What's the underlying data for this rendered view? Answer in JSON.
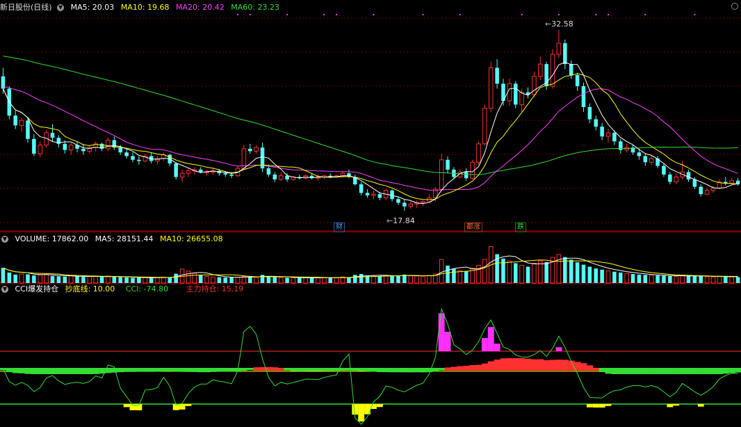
{
  "price_panel": {
    "title": "新日股份(日线)",
    "ma_labels": [
      {
        "text": "MA5: 20.03",
        "color": "#ffffff"
      },
      {
        "text": "MA10: 19.68",
        "color": "#ffff00"
      },
      {
        "text": "MA20: 20.42",
        "color": "#ff40ff"
      },
      {
        "text": "MA60: 23.23",
        "color": "#33dd33"
      }
    ],
    "high_label": "32.58",
    "low_label": "17.84",
    "flags": [
      {
        "text": "财",
        "color": "#4aa3ff"
      },
      {
        "text": "都涨",
        "color": "#ff6a3a"
      },
      {
        "text": "跌",
        "color": "#33dd33"
      }
    ]
  },
  "volume_panel": {
    "labels": [
      {
        "text": "VOLUME: 17862.00",
        "color": "#ffffff"
      },
      {
        "text": "MA5: 28151.44",
        "color": "#ffffff"
      },
      {
        "text": "MA10: 26655.08",
        "color": "#ffff00"
      }
    ]
  },
  "cci_panel": {
    "labels": [
      {
        "text": "CCI爆发持仓",
        "color": "#ffffff"
      },
      {
        "text": "抄底线: 10.00",
        "color": "#ffff00"
      },
      {
        "text": "CCI: -74.80",
        "color": "#33dd33"
      },
      {
        "text": "主力持仓: 15.19",
        "color": "#ff3030"
      }
    ]
  },
  "colors": {
    "up": "#ff3030",
    "down": "#54fcfc",
    "ma5": "#ffffff",
    "ma10": "#ffff00",
    "ma20": "#ff40ff",
    "ma60": "#33dd33",
    "grid": "#7a0000",
    "divider": "#a00000"
  },
  "chart_data": {
    "type": "candlestick",
    "high": 32.58,
    "low": 17.84,
    "ohlc": [
      [
        28.8,
        29.5,
        27.4,
        27.8
      ],
      [
        27.8,
        28.0,
        25.3,
        25.6
      ],
      [
        25.6,
        26.0,
        24.5,
        24.8
      ],
      [
        24.8,
        25.4,
        24.3,
        25.2
      ],
      [
        25.2,
        25.5,
        23.4,
        23.7
      ],
      [
        23.7,
        24.1,
        22.3,
        22.5
      ],
      [
        22.5,
        23.5,
        22.2,
        23.2
      ],
      [
        23.2,
        24.4,
        23.0,
        24.2
      ],
      [
        24.2,
        24.9,
        23.5,
        23.8
      ],
      [
        23.8,
        24.0,
        23.0,
        23.3
      ],
      [
        23.3,
        23.6,
        22.5,
        22.8
      ],
      [
        22.8,
        23.4,
        22.4,
        23.2
      ],
      [
        23.2,
        23.5,
        22.6,
        22.9
      ],
      [
        22.9,
        23.3,
        22.4,
        22.7
      ],
      [
        22.7,
        23.2,
        22.5,
        23.0
      ],
      [
        23.0,
        23.5,
        22.7,
        23.3
      ],
      [
        23.3,
        23.4,
        22.7,
        22.9
      ],
      [
        22.9,
        23.8,
        22.7,
        23.6
      ],
      [
        23.6,
        23.9,
        22.8,
        23.0
      ],
      [
        23.0,
        23.2,
        22.4,
        22.6
      ],
      [
        22.6,
        22.9,
        22.1,
        22.3
      ],
      [
        22.3,
        22.6,
        21.8,
        22.0
      ],
      [
        22.0,
        22.3,
        21.6,
        21.9
      ],
      [
        21.9,
        22.5,
        21.8,
        22.3
      ],
      [
        22.3,
        22.6,
        21.7,
        21.9
      ],
      [
        21.9,
        22.3,
        21.6,
        22.1
      ],
      [
        22.1,
        22.6,
        21.9,
        22.4
      ],
      [
        22.4,
        22.5,
        21.5,
        21.7
      ],
      [
        21.7,
        21.8,
        20.4,
        20.6
      ],
      [
        20.6,
        21.2,
        20.2,
        20.9
      ],
      [
        20.9,
        21.3,
        20.6,
        21.1
      ],
      [
        21.1,
        21.4,
        20.8,
        21.2
      ],
      [
        21.2,
        21.4,
        20.9,
        21.0
      ],
      [
        21.0,
        21.2,
        20.7,
        21.0
      ],
      [
        21.0,
        21.3,
        20.8,
        21.1
      ],
      [
        21.1,
        21.2,
        20.7,
        20.9
      ],
      [
        20.9,
        21.1,
        20.6,
        20.8
      ],
      [
        20.8,
        21.0,
        20.5,
        20.7
      ],
      [
        20.7,
        21.5,
        20.6,
        21.3
      ],
      [
        21.3,
        23.2,
        21.2,
        22.9
      ],
      [
        22.9,
        23.3,
        22.5,
        22.7
      ],
      [
        22.7,
        23.2,
        22.5,
        23.0
      ],
      [
        23.0,
        23.4,
        21.0,
        21.3
      ],
      [
        21.3,
        21.6,
        20.6,
        20.8
      ],
      [
        20.8,
        21.0,
        20.2,
        20.4
      ],
      [
        20.4,
        21.0,
        20.3,
        20.7
      ],
      [
        20.7,
        20.9,
        20.2,
        20.4
      ],
      [
        20.4,
        20.7,
        20.3,
        20.6
      ],
      [
        20.6,
        20.8,
        20.4,
        20.5
      ],
      [
        20.5,
        20.8,
        20.4,
        20.7
      ],
      [
        20.7,
        20.9,
        20.4,
        20.5
      ],
      [
        20.5,
        20.8,
        20.3,
        20.6
      ],
      [
        20.6,
        20.8,
        20.4,
        20.7
      ],
      [
        20.7,
        20.9,
        20.5,
        20.6
      ],
      [
        20.6,
        20.8,
        20.5,
        20.7
      ],
      [
        20.7,
        21.1,
        20.6,
        20.9
      ],
      [
        20.9,
        21.2,
        20.5,
        20.6
      ],
      [
        20.6,
        20.8,
        19.9,
        20.0
      ],
      [
        20.0,
        20.2,
        19.1,
        19.3
      ],
      [
        19.3,
        19.6,
        18.9,
        19.1
      ],
      [
        19.1,
        19.5,
        18.8,
        19.2
      ],
      [
        19.2,
        19.4,
        18.7,
        18.9
      ],
      [
        18.9,
        19.6,
        18.7,
        19.5
      ],
      [
        19.5,
        19.6,
        18.6,
        18.8
      ],
      [
        18.8,
        19.0,
        18.3,
        18.5
      ],
      [
        18.5,
        18.8,
        17.84,
        18.2
      ],
      [
        18.2,
        18.6,
        18.0,
        18.4
      ],
      [
        18.4,
        18.7,
        18.1,
        18.5
      ],
      [
        18.5,
        18.7,
        18.2,
        18.6
      ],
      [
        18.6,
        19.2,
        18.5,
        18.9
      ],
      [
        18.9,
        19.8,
        18.6,
        19.6
      ],
      [
        19.6,
        22.5,
        19.5,
        22.0
      ],
      [
        22.0,
        22.3,
        20.9,
        21.2
      ],
      [
        21.2,
        21.4,
        20.4,
        20.6
      ],
      [
        20.6,
        21.2,
        20.5,
        21.0
      ],
      [
        21.0,
        21.3,
        20.3,
        20.5
      ],
      [
        20.5,
        22.0,
        20.4,
        21.8
      ],
      [
        21.8,
        23.5,
        21.6,
        23.3
      ],
      [
        23.3,
        26.5,
        23.1,
        26.2
      ],
      [
        26.2,
        30.0,
        25.9,
        29.5
      ],
      [
        29.5,
        30.2,
        27.8,
        28.2
      ],
      [
        28.2,
        28.6,
        26.4,
        26.8
      ],
      [
        26.8,
        28.6,
        26.4,
        28.2
      ],
      [
        28.2,
        28.4,
        26.2,
        26.5
      ],
      [
        26.5,
        27.8,
        25.9,
        27.5
      ],
      [
        27.5,
        27.9,
        27.0,
        27.3
      ],
      [
        27.3,
        29.2,
        27.1,
        28.8
      ],
      [
        28.8,
        30.4,
        28.5,
        29.8
      ],
      [
        29.8,
        30.0,
        27.7,
        28.0
      ],
      [
        28.0,
        31.0,
        27.8,
        30.6
      ],
      [
        30.6,
        32.58,
        30.3,
        31.5
      ],
      [
        31.5,
        31.8,
        29.4,
        29.8
      ],
      [
        29.8,
        30.1,
        28.6,
        28.9
      ],
      [
        28.9,
        29.1,
        27.6,
        28.0
      ],
      [
        28.0,
        28.3,
        25.9,
        26.3
      ],
      [
        26.3,
        26.6,
        25.0,
        25.3
      ],
      [
        25.3,
        25.6,
        24.4,
        24.7
      ],
      [
        24.7,
        25.0,
        23.6,
        23.9
      ],
      [
        23.9,
        24.5,
        23.4,
        24.2
      ],
      [
        24.2,
        24.4,
        23.2,
        23.5
      ],
      [
        23.5,
        23.7,
        22.5,
        22.8
      ],
      [
        22.8,
        23.3,
        22.6,
        23.0
      ],
      [
        23.0,
        23.2,
        22.4,
        22.6
      ],
      [
        22.6,
        22.9,
        22.0,
        22.3
      ],
      [
        22.3,
        22.5,
        21.5,
        21.8
      ],
      [
        21.8,
        22.4,
        21.6,
        22.1
      ],
      [
        22.1,
        22.3,
        21.3,
        21.5
      ],
      [
        21.5,
        21.7,
        20.6,
        20.8
      ],
      [
        20.8,
        21.0,
        20.0,
        20.2
      ],
      [
        20.2,
        20.9,
        20.0,
        20.6
      ],
      [
        20.6,
        21.9,
        20.4,
        21.0
      ],
      [
        21.0,
        21.2,
        20.2,
        20.4
      ],
      [
        20.4,
        20.6,
        19.6,
        19.8
      ],
      [
        19.8,
        20.0,
        19.0,
        19.2
      ],
      [
        19.2,
        19.7,
        19.1,
        19.5
      ],
      [
        19.5,
        19.9,
        19.3,
        19.7
      ],
      [
        19.7,
        20.4,
        19.6,
        20.2
      ],
      [
        20.2,
        20.6,
        19.9,
        20.1
      ],
      [
        20.1,
        20.5,
        19.9,
        20.3
      ],
      [
        20.3,
        20.5,
        19.9,
        20.0
      ]
    ],
    "volume": [
      5200,
      3600,
      2900,
      3100,
      3000,
      2600,
      2800,
      3000,
      2400,
      2300,
      2200,
      2500,
      2300,
      2100,
      2200,
      2300,
      2100,
      2400,
      2200,
      2000,
      1900,
      1800,
      1800,
      1900,
      1800,
      1900,
      2000,
      1900,
      3200,
      4800,
      4100,
      3400,
      2700,
      2300,
      2100,
      2000,
      1900,
      1900,
      2000,
      2300,
      2200,
      2000,
      2800,
      2400,
      2000,
      1900,
      1800,
      1800,
      1800,
      1800,
      1900,
      1800,
      1800,
      1900,
      1800,
      2100,
      2000,
      2800,
      3100,
      2600,
      2500,
      2400,
      2600,
      2500,
      2400,
      2900,
      2500,
      2400,
      2300,
      2600,
      3100,
      8100,
      6000,
      4900,
      4300,
      4100,
      5100,
      6100,
      8100,
      12500,
      9900,
      8400,
      7600,
      6800,
      6100,
      5600,
      6800,
      7600,
      7200,
      8800,
      9800,
      8900,
      8000,
      7100,
      6300,
      5600,
      5000,
      4600,
      4200,
      3900,
      3600,
      3300,
      3100,
      2900,
      2800,
      2700,
      2600,
      2500,
      2400,
      2300,
      2600,
      2500,
      2400,
      2300,
      2200,
      2100,
      2300,
      2200,
      2100,
      2000
    ]
  }
}
